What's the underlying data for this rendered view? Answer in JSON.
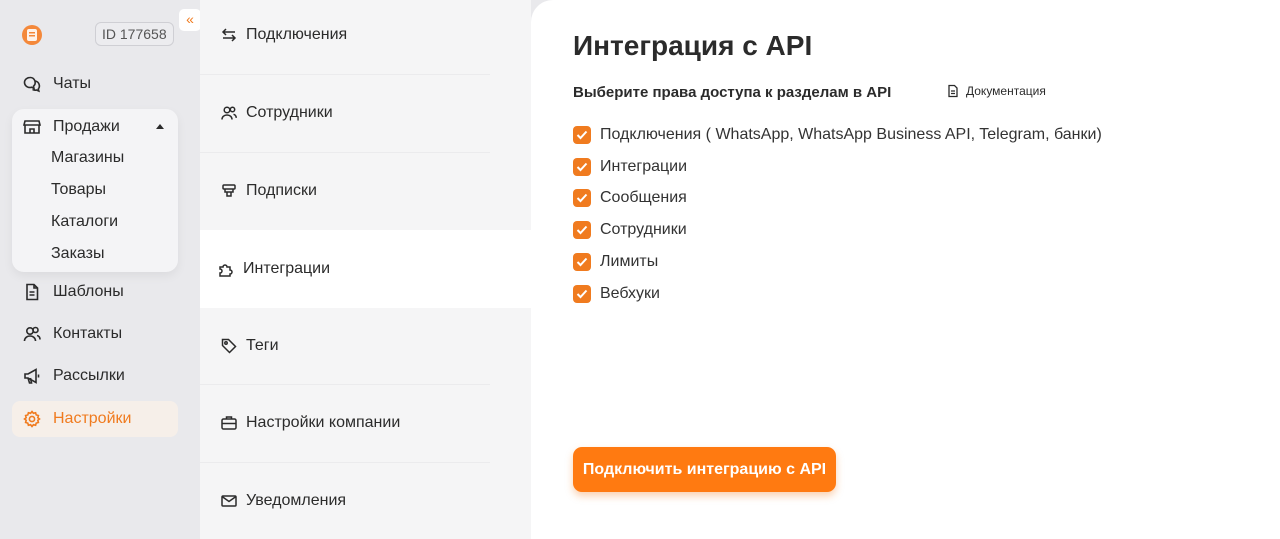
{
  "header": {
    "account_id": "ID 177658",
    "collapse_glyph": "«"
  },
  "nav": {
    "items": [
      {
        "label": "Чаты",
        "icon": "chat-icon"
      },
      {
        "label": "Шаблоны",
        "icon": "document-icon"
      },
      {
        "label": "Контакты",
        "icon": "users-icon"
      },
      {
        "label": "Рассылки",
        "icon": "megaphone-icon"
      },
      {
        "label": "Настройки",
        "icon": "gear-icon"
      }
    ],
    "sales": {
      "label": "Продажи",
      "icon": "store-icon",
      "children": [
        "Магазины",
        "Товары",
        "Каталоги",
        "Заказы"
      ]
    },
    "active": "Настройки"
  },
  "settings_menu": {
    "items": [
      {
        "label": "Подключения",
        "icon": "arrows-icon"
      },
      {
        "label": "Сотрудники",
        "icon": "users-icon"
      },
      {
        "label": "Подписки",
        "icon": "cards-icon"
      },
      {
        "label": "Интеграции",
        "icon": "puzzle-icon"
      },
      {
        "label": "Теги",
        "icon": "tag-icon"
      },
      {
        "label": "Настройки компании",
        "icon": "briefcase-icon"
      },
      {
        "label": "Уведомления",
        "icon": "mail-icon"
      }
    ],
    "active": "Интеграции"
  },
  "main": {
    "title": "Интеграция с API",
    "subtitle": "Выберите права доступа к разделам в API",
    "doc_link": "Документация",
    "permissions": [
      {
        "label": "Подключения ( WhatsApp, WhatsApp Business API, Telegram, банки)",
        "checked": true
      },
      {
        "label": "Интеграции",
        "checked": true
      },
      {
        "label": "Сообщения",
        "checked": true
      },
      {
        "label": "Сотрудники",
        "checked": true
      },
      {
        "label": "Лимиты",
        "checked": true
      },
      {
        "label": "Вебхуки",
        "checked": true
      }
    ],
    "connect_button": "Подключить интеграцию с API"
  },
  "colors": {
    "accent": "#f07b1f",
    "button": "#ff7a11",
    "active_nav_bg": "#f6efe9"
  }
}
